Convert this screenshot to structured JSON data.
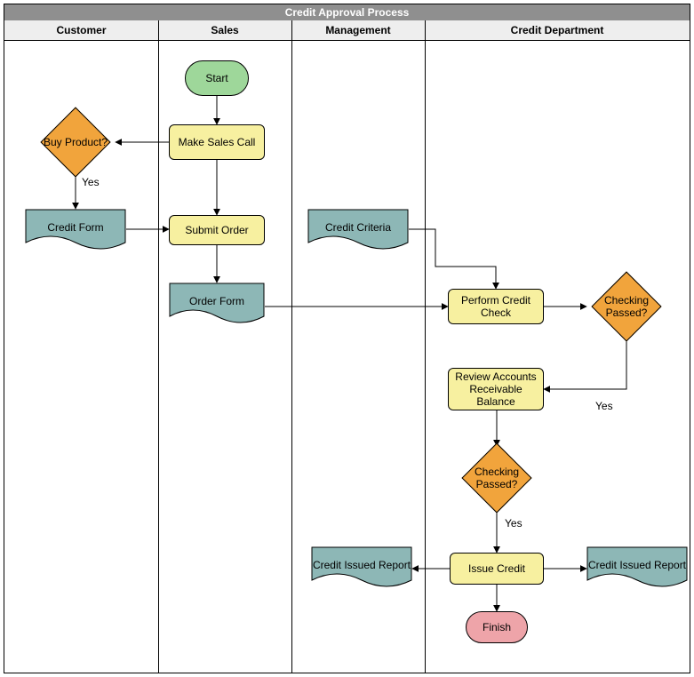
{
  "title": "Credit Approval Process",
  "lanes": {
    "customer": "Customer",
    "sales": "Sales",
    "management": "Management",
    "credit": "Credit Department"
  },
  "nodes": {
    "start": "Start",
    "make_sales_call": "Make Sales Call",
    "buy_product": "Buy Product?",
    "credit_form": "Credit Form",
    "submit_order": "Submit Order",
    "order_form": "Order Form",
    "credit_criteria": "Credit Criteria",
    "perform_credit_check": "Perform Credit Check",
    "checking_passed_1": "Checking Passed?",
    "review_ar": "Review Accounts Receivable Balance",
    "checking_passed_2": "Checking Passed?",
    "issue_credit": "Issue Credit",
    "credit_issued_report_left": "Credit Issued Report",
    "credit_issued_report_right": "Credit Issued Report",
    "finish": "Finish"
  },
  "edges": {
    "yes1": "Yes",
    "yes2": "Yes",
    "yes3": "Yes"
  },
  "chart_data": {
    "type": "swimlane-flowchart",
    "title": "Credit Approval Process",
    "lanes": [
      "Customer",
      "Sales",
      "Management",
      "Credit Department"
    ],
    "nodes": [
      {
        "id": "start",
        "type": "terminator",
        "label": "Start",
        "lane": "Sales"
      },
      {
        "id": "make_sales_call",
        "type": "process",
        "label": "Make Sales Call",
        "lane": "Sales"
      },
      {
        "id": "buy_product",
        "type": "decision",
        "label": "Buy Product?",
        "lane": "Customer"
      },
      {
        "id": "credit_form",
        "type": "document",
        "label": "Credit Form",
        "lane": "Customer"
      },
      {
        "id": "submit_order",
        "type": "process",
        "label": "Submit Order",
        "lane": "Sales"
      },
      {
        "id": "order_form",
        "type": "document",
        "label": "Order Form",
        "lane": "Sales"
      },
      {
        "id": "credit_criteria",
        "type": "document",
        "label": "Credit Criteria",
        "lane": "Management"
      },
      {
        "id": "perform_credit_check",
        "type": "process",
        "label": "Perform Credit Check",
        "lane": "Credit Department"
      },
      {
        "id": "checking_passed_1",
        "type": "decision",
        "label": "Checking Passed?",
        "lane": "Credit Department"
      },
      {
        "id": "review_ar",
        "type": "process",
        "label": "Review Accounts Receivable Balance",
        "lane": "Credit Department"
      },
      {
        "id": "checking_passed_2",
        "type": "decision",
        "label": "Checking Passed?",
        "lane": "Credit Department"
      },
      {
        "id": "issue_credit",
        "type": "process",
        "label": "Issue Credit",
        "lane": "Credit Department"
      },
      {
        "id": "credit_issued_report_left",
        "type": "document",
        "label": "Credit Issued Report",
        "lane": "Management"
      },
      {
        "id": "credit_issued_report_right",
        "type": "document",
        "label": "Credit Issued Report",
        "lane": "Credit Department"
      },
      {
        "id": "finish",
        "type": "terminator",
        "label": "Finish",
        "lane": "Credit Department"
      }
    ],
    "edges": [
      {
        "from": "start",
        "to": "make_sales_call"
      },
      {
        "from": "make_sales_call",
        "to": "buy_product"
      },
      {
        "from": "buy_product",
        "to": "credit_form",
        "label": "Yes"
      },
      {
        "from": "make_sales_call",
        "to": "submit_order"
      },
      {
        "from": "credit_form",
        "to": "submit_order"
      },
      {
        "from": "submit_order",
        "to": "order_form"
      },
      {
        "from": "order_form",
        "to": "perform_credit_check"
      },
      {
        "from": "credit_criteria",
        "to": "perform_credit_check"
      },
      {
        "from": "perform_credit_check",
        "to": "checking_passed_1"
      },
      {
        "from": "checking_passed_1",
        "to": "review_ar",
        "label": "Yes"
      },
      {
        "from": "review_ar",
        "to": "checking_passed_2"
      },
      {
        "from": "checking_passed_2",
        "to": "issue_credit",
        "label": "Yes"
      },
      {
        "from": "issue_credit",
        "to": "credit_issued_report_left"
      },
      {
        "from": "issue_credit",
        "to": "credit_issued_report_right"
      },
      {
        "from": "issue_credit",
        "to": "finish"
      }
    ]
  }
}
